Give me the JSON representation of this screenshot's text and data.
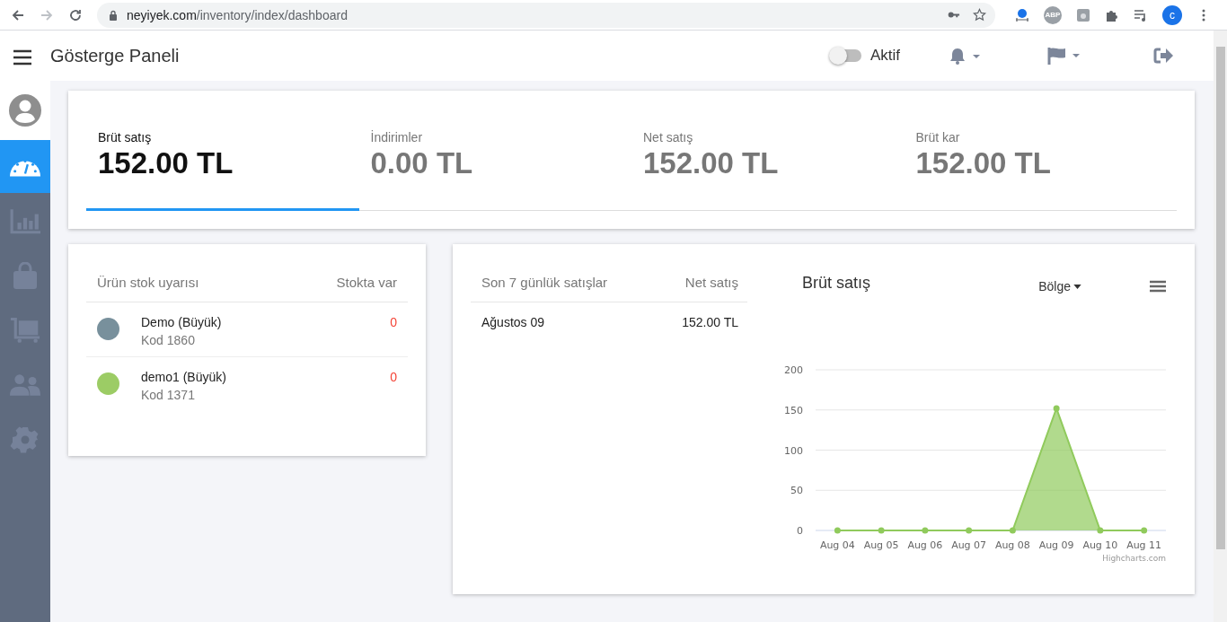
{
  "browser": {
    "url_host": "neyiyek.com",
    "url_path": "/inventory/index/dashboard",
    "abp": "ABP",
    "profile_initial": "c"
  },
  "header": {
    "title": "Gösterge Paneli",
    "toggle": {
      "label": "Aktif",
      "on": false
    }
  },
  "sidebar": {
    "items": [
      {
        "kind": "dashboard",
        "selected": true
      },
      {
        "kind": "chart",
        "selected": false
      },
      {
        "kind": "bag",
        "selected": false
      },
      {
        "kind": "cart",
        "selected": false
      },
      {
        "kind": "users",
        "selected": false
      },
      {
        "kind": "settings",
        "selected": false
      }
    ]
  },
  "stats": [
    {
      "label": "Brüt satış",
      "value": "152.00 TL",
      "selected": true
    },
    {
      "label": "İndirimler",
      "value": "0.00 TL",
      "selected": false
    },
    {
      "label": "Net satış",
      "value": "152.00 TL",
      "selected": false
    },
    {
      "label": "Brüt kar",
      "value": "152.00 TL",
      "selected": false
    }
  ],
  "stock": {
    "columns": [
      "Ürün stok uyarısı",
      "Stokta var"
    ],
    "items": [
      {
        "name": "Demo (Büyük)",
        "code": "Kod 1860",
        "count": "0",
        "color": "#78909c"
      },
      {
        "name": "demo1 (Büyük)",
        "code": "Kod 1371",
        "count": "0",
        "color": "#9ccc65"
      }
    ]
  },
  "sales": {
    "columns": [
      "Son 7 günlük satışlar",
      "Net satış"
    ],
    "rows": [
      {
        "date": "Ağustos 09",
        "amount": "152.00 TL"
      }
    ]
  },
  "chart": {
    "region_label": "Bölge",
    "credit": "Highcharts.com",
    "chart_data": {
      "type": "area",
      "categories": [
        "Aug 04",
        "Aug 05",
        "Aug 06",
        "Aug 07",
        "Aug 08",
        "Aug 09",
        "Aug 10",
        "Aug 11"
      ],
      "series": [
        {
          "name": "Brüt satış",
          "color": "#90ca5c",
          "values": [
            0,
            0,
            0,
            0,
            0,
            152,
            0,
            0
          ]
        }
      ],
      "grid": true,
      "ylim": [
        0,
        200
      ],
      "yticks": [
        0,
        50,
        100,
        150,
        200
      ]
    }
  }
}
